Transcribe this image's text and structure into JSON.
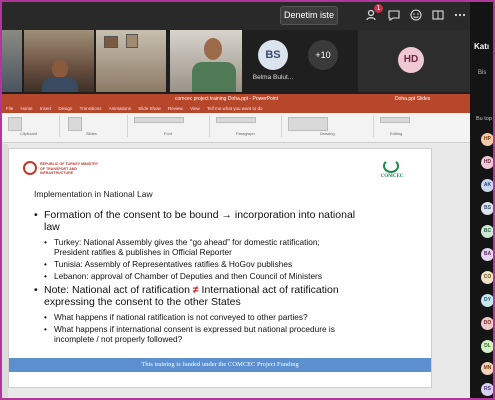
{
  "topbar": {
    "button_label": "Denetim iste",
    "notification_count": "1",
    "icons": [
      "people-icon",
      "chat-icon",
      "reactions-icon",
      "view-icon",
      "more-icon"
    ]
  },
  "participants_strip": {
    "bs_initials": "BS",
    "bs_name": "Belma Bulut...",
    "overflow_count": "+10",
    "hd_initials": "HD"
  },
  "powerpoint": {
    "title_text": "comcec project training Doha.ppt - PowerPoint",
    "title_right": "Doha.ppt  Slides",
    "tabs": [
      "File",
      "Home",
      "Insert",
      "Design",
      "Transitions",
      "Animations",
      "Slide Show",
      "Review",
      "View",
      "Tell me what you want to do"
    ],
    "ribbon_groups": [
      "Clipboard",
      "Slides",
      "Font",
      "Paragraph",
      "Drawing",
      "Editing"
    ]
  },
  "slide": {
    "logo_left_text": "REPUBLIC OF TURKEY MINISTRY OF TRANSPORT AND INFRASTRUCTURE",
    "logo_right_text": "COMCEC",
    "heading": "Implementation in National Law",
    "bullet1_line1": "Formation of the consent to be bound → incorporation into national",
    "bullet1_line2": "law",
    "sub1_line1": "Turkey: National Assembly gives the “go ahead” for domestic ratification;",
    "sub1_line2": "President ratifies & publishes in Official Reporter",
    "sub2": "Tunisia: Assembly of Representatives ratifies & HoGov publishes",
    "sub3": "Lebanon: approval of Chamber of Deputies and then Council of Ministers",
    "bullet2_pre": "Note: National act of ratification",
    "bullet2_neq": "≠",
    "bullet2_post": "International act of ratification",
    "bullet2_line2": "expressing the consent to the other States",
    "sub4": "What happens if national ratification is not conveyed to other parties?",
    "sub5_line1": "What happens if international consent is expressed but national procedure is",
    "sub5_line2": "incomplete / not properly followed?",
    "footer": "This training is funded under the COMCEC Project Funding"
  },
  "rail": {
    "title": "Katı",
    "subtitle": "Bis",
    "section": "Bu top",
    "avatars": [
      {
        "initials": "HP",
        "bg": "#f4c9a8",
        "fg": "#7a3c12"
      },
      {
        "initials": "HD",
        "bg": "#f0c8d4",
        "fg": "#6b2a44"
      },
      {
        "initials": "AK",
        "bg": "#c9d7f0",
        "fg": "#22407a"
      },
      {
        "initials": "BS",
        "bg": "#dbe3ee",
        "fg": "#3b4a6b"
      },
      {
        "initials": "BC",
        "bg": "#cfe8d4",
        "fg": "#23613a"
      },
      {
        "initials": "BA",
        "bg": "#e8d4f0",
        "fg": "#5a2a72"
      },
      {
        "initials": "CO",
        "bg": "#f0e3c8",
        "fg": "#6e4f12"
      },
      {
        "initials": "DY",
        "bg": "#c8e6ee",
        "fg": "#1f5866"
      },
      {
        "initials": "DO",
        "bg": "#f0c8c8",
        "fg": "#7a2222"
      },
      {
        "initials": "DL",
        "bg": "#d6f0c8",
        "fg": "#3a6a1c"
      },
      {
        "initials": "MN",
        "bg": "#f4d2b8",
        "fg": "#7a3c12"
      },
      {
        "initials": "RS",
        "bg": "#dad0f0",
        "fg": "#46307a"
      }
    ]
  }
}
